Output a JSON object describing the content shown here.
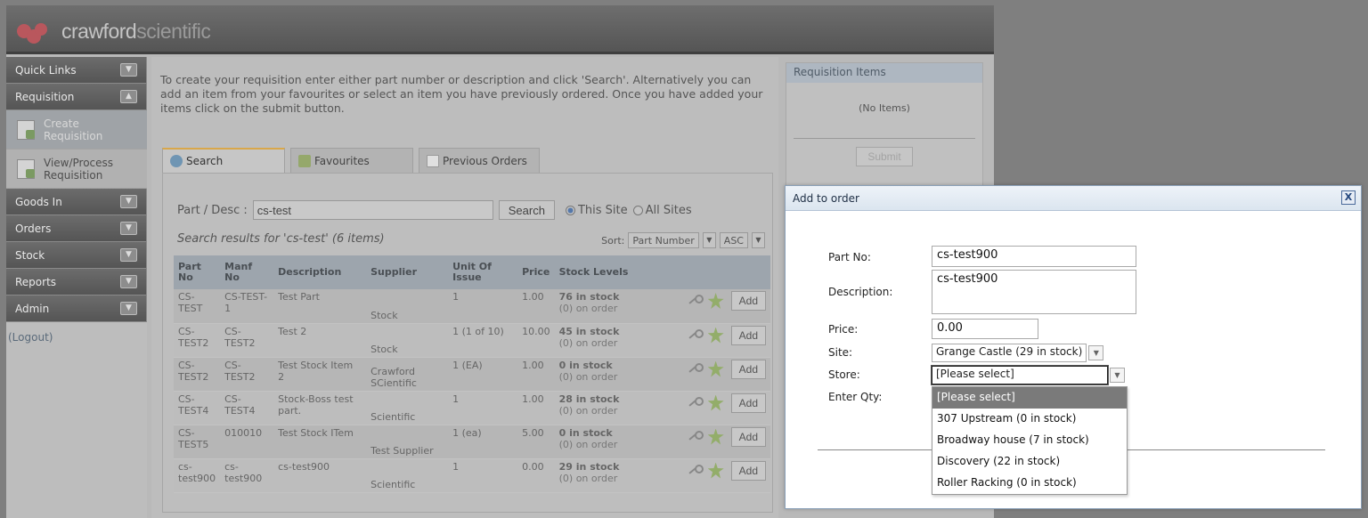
{
  "header": {
    "brand_part1": "crawford",
    "brand_part2": "scientific"
  },
  "sidebar": {
    "sections": [
      {
        "label": "Quick Links"
      },
      {
        "label": "Requisition"
      },
      {
        "label": "Goods In"
      },
      {
        "label": "Orders"
      },
      {
        "label": "Stock"
      },
      {
        "label": "Reports"
      },
      {
        "label": "Admin"
      }
    ],
    "requisition_items": [
      {
        "label": "Create\nRequisition"
      },
      {
        "label": "View/Process\nRequisition"
      }
    ],
    "logout": "(Logout)"
  },
  "main": {
    "intro": "To create your requisition enter either part number or description and click 'Search'. Alternatively you can add an item from your favourites or select an item you have previously ordered. Once you have added your items click on the submit button.",
    "tabs": [
      "Search",
      "Favourites",
      "Previous Orders"
    ],
    "search": {
      "label": "Part / Desc :",
      "value": "cs-test",
      "button": "Search",
      "radio_this": "This Site",
      "radio_all": "All Sites",
      "results_text": "Search results for 'cs-test' (6 items)",
      "sort_label": "Sort:",
      "sort_field": "Part Number",
      "sort_dir": "ASC"
    },
    "table": {
      "columns": [
        "Part No",
        "Manf No",
        "Description",
        "Supplier",
        "Unit Of Issue",
        "Price",
        "Stock Levels"
      ],
      "add_label": "Add",
      "rows": [
        {
          "part": "CS-TEST",
          "manf": "CS-TEST-1",
          "desc": "Test Part",
          "supplier": "Stock",
          "unit": "1",
          "price": "1.00",
          "stock": "76 in stock",
          "order": "(0) on order"
        },
        {
          "part": "CS-TEST2",
          "manf": "CS-TEST2",
          "desc": "Test 2",
          "supplier": "Stock",
          "unit": "1 (1 of 10)",
          "price": "10.00",
          "stock": "45 in stock",
          "order": "(0) on order"
        },
        {
          "part": "CS-TEST2",
          "manf": "CS-TEST2",
          "desc": "Test Stock Item 2",
          "supplier": "Crawford SCientific",
          "unit": "1 (EA)",
          "price": "1.00",
          "stock": "0 in stock",
          "order": "(0) on order"
        },
        {
          "part": "CS-TEST4",
          "manf": "CS-TEST4",
          "desc": "Stock-Boss test part.",
          "supplier": "Scientific",
          "unit": "1",
          "price": "1.00",
          "stock": "28 in stock",
          "order": "(0) on order"
        },
        {
          "part": "CS-TEST5",
          "manf": "010010",
          "desc": "Test Stock ITem",
          "supplier": "Test Supplier",
          "unit": "1 (ea)",
          "price": "5.00",
          "stock": "0 in stock",
          "order": "(0) on order"
        },
        {
          "part": "cs-test900",
          "manf": "cs-test900",
          "desc": "cs-test900",
          "supplier": "Scientific",
          "unit": "1",
          "price": "0.00",
          "stock": "29 in stock",
          "order": "(0) on order"
        }
      ]
    }
  },
  "requisition_panel": {
    "title": "Requisition Items",
    "empty": "(No Items)",
    "submit": "Submit"
  },
  "dialog": {
    "title": "Add to order",
    "close": "X",
    "part_label": "Part No:",
    "part_value": "cs-test900",
    "desc_label": "Description:",
    "desc_value": "cs-test900",
    "price_label": "Price:",
    "price_value": "0.00",
    "site_label": "Site:",
    "site_value": "Grange Castle (29 in stock)",
    "store_label": "Store:",
    "store_value": "[Please select]",
    "qty_label": "Enter Qty:",
    "store_options": [
      "[Please select]",
      "307 Upstream (0 in stock)",
      "Broadway house (7 in stock)",
      "Discovery (22 in stock)",
      "Roller Racking (0 in stock)"
    ]
  }
}
